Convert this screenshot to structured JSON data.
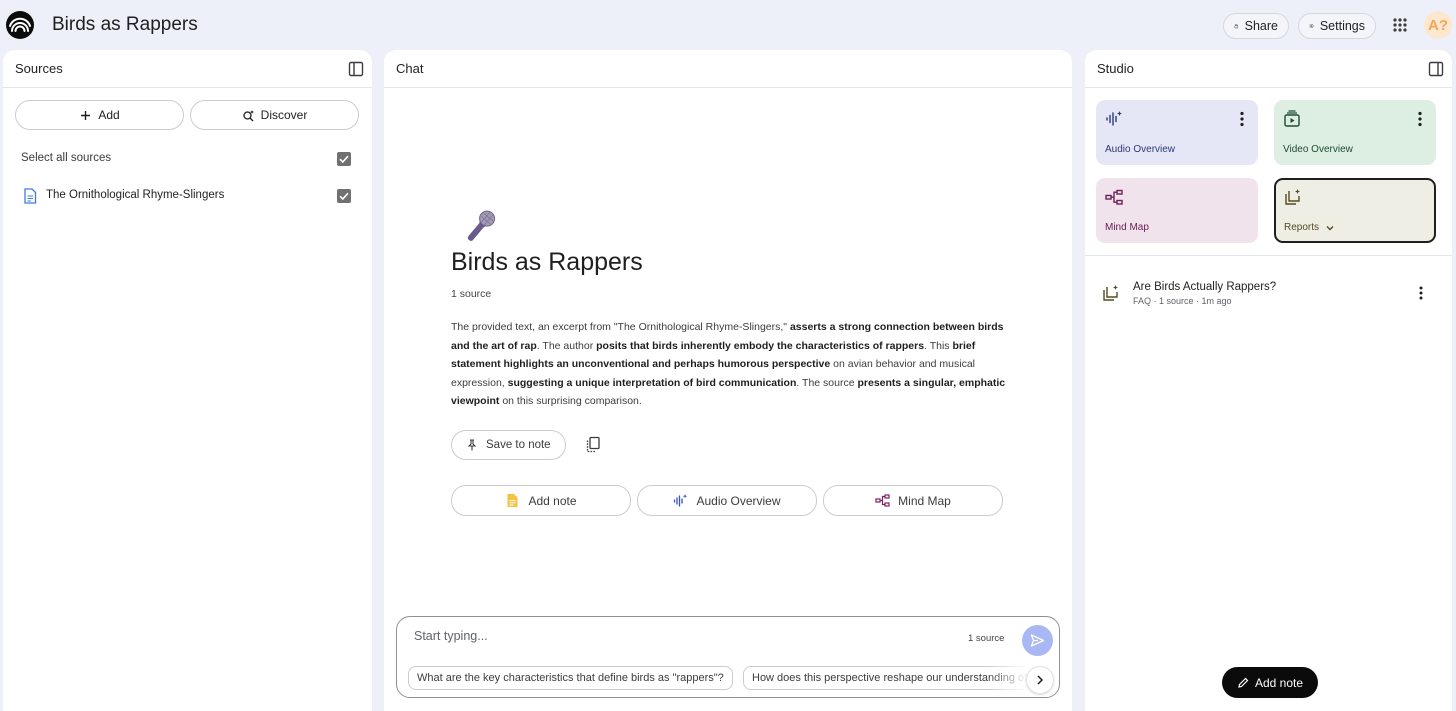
{
  "header": {
    "title": "Birds as Rappers",
    "share_label": "Share",
    "settings_label": "Settings",
    "avatar_text": "A?"
  },
  "sources": {
    "title": "Sources",
    "add_label": "Add",
    "discover_label": "Discover",
    "select_all_label": "Select all sources",
    "items": [
      {
        "name": "The Ornithological Rhyme-Slingers",
        "checked": true
      }
    ]
  },
  "chat": {
    "title": "Chat",
    "notebook_title": "Birds as Rappers",
    "source_count": "1 source",
    "summary_parts": [
      {
        "text": "The provided text, an excerpt from \"The Ornithological Rhyme-Slingers,\" ",
        "bold": false
      },
      {
        "text": "asserts a strong connection between birds and the art of rap",
        "bold": true
      },
      {
        "text": ". The author ",
        "bold": false
      },
      {
        "text": "posits that birds inherently embody the characteristics of rappers",
        "bold": true
      },
      {
        "text": ". This ",
        "bold": false
      },
      {
        "text": "brief statement highlights an unconventional and perhaps humorous perspective",
        "bold": true
      },
      {
        "text": " on avian behavior and musical expression, ",
        "bold": false
      },
      {
        "text": "suggesting a unique interpretation of bird communication",
        "bold": true
      },
      {
        "text": ". The source ",
        "bold": false
      },
      {
        "text": "presents a singular, emphatic viewpoint",
        "bold": true
      },
      {
        "text": " on this surprising comparison.",
        "bold": false
      }
    ],
    "save_note_label": "Save to note",
    "actions": {
      "add_note": "Add note",
      "audio_overview": "Audio Overview",
      "mind_map": "Mind Map"
    },
    "composer": {
      "placeholder": "Start typing...",
      "source_count": "1 source",
      "suggestions": [
        "What are the key characteristics that define birds as \"rappers\"?",
        "How does this perspective reshape our understanding of"
      ]
    }
  },
  "studio": {
    "title": "Studio",
    "tiles": {
      "audio": "Audio Overview",
      "video": "Video Overview",
      "mind_map": "Mind Map",
      "reports": "Reports"
    },
    "notes": [
      {
        "title": "Are Birds Actually Rappers?",
        "meta": "FAQ · 1 source · 1m ago"
      }
    ],
    "add_note_label": "Add note"
  },
  "colors": {
    "background": "#edf0f8",
    "audio_tile": "#e5e7f6",
    "video_tile": "#dcefe2",
    "mind_map_tile": "#f0e3ec",
    "reports_tile": "#eeeee4",
    "send_button": "#a9b7f4"
  },
  "icons": [
    "logo-icon",
    "lock-icon",
    "gear-icon",
    "apps-grid-icon",
    "panel-toggle-icon",
    "plus-icon",
    "discover-icon",
    "checkbox-icon",
    "document-icon",
    "microphone-icon",
    "pin-icon",
    "copy-icon",
    "note-icon",
    "audio-wave-icon",
    "mind-map-icon",
    "send-icon",
    "chevron-right-icon",
    "video-icon",
    "report-icon",
    "more-vert-icon",
    "pencil-icon",
    "chevron-down-icon"
  ]
}
